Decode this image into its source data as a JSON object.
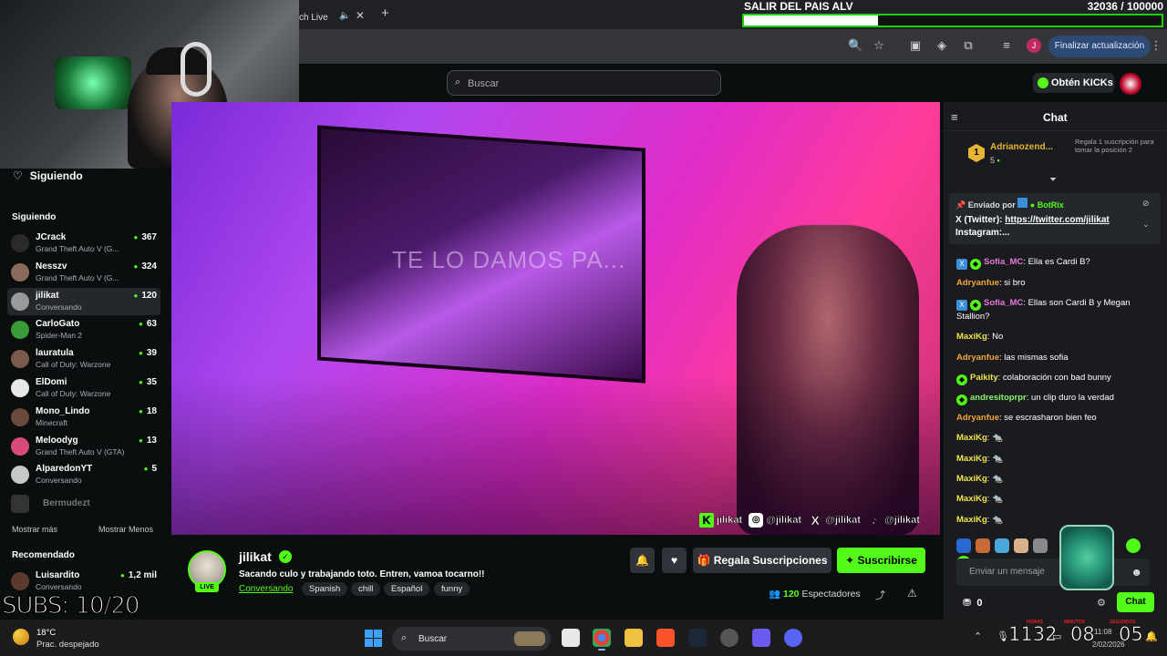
{
  "browser": {
    "tab_title": "ch Live",
    "update_button": "Finalizar actualización",
    "profile_initial": "J"
  },
  "goal": {
    "title": "SALIR DEL PAIS ALV",
    "count": "32036  / 100000",
    "progress_fraction": 0.32
  },
  "header": {
    "search_placeholder": "Buscar",
    "kicks_label": "Obtén KICKs"
  },
  "sidebar": {
    "following_header": "Siguiendo",
    "following_section": "Siguiendo",
    "channels": [
      {
        "name": "JCrack",
        "game": "Grand Theft Auto V (G...",
        "viewers": "367",
        "color": "#2a2a2a"
      },
      {
        "name": "Nesszv",
        "game": "Grand Theft Auto V (G...",
        "viewers": "324",
        "color": "#8a6a5a"
      },
      {
        "name": "jilikat",
        "game": "Conversando",
        "viewers": "120",
        "color": "#9a9a9a"
      },
      {
        "name": "CarloGato",
        "game": "Spider-Man 2",
        "viewers": "63",
        "color": "#3a9a3a"
      },
      {
        "name": "lauratula",
        "game": "Call of Duty: Warzone",
        "viewers": "39",
        "color": "#7a5a4a"
      },
      {
        "name": "ElDomi",
        "game": "Call of Duty: Warzone",
        "viewers": "35",
        "color": "#e8e8e8"
      },
      {
        "name": "Mono_Lindo",
        "game": "Minecraft",
        "viewers": "18",
        "color": "#6a4a3a"
      },
      {
        "name": "Meloodyg",
        "game": "Grand Theft Auto V (GTA)",
        "viewers": "13",
        "color": "#d84a7a"
      },
      {
        "name": "AlparedonYT",
        "game": "Conversando",
        "viewers": "5",
        "color": "#c8c8c8"
      }
    ],
    "offline_channel": "Bermudezt",
    "show_more": "Mostrar más",
    "show_less": "Mostrar Menos",
    "recommended_section": "Recomendado",
    "recommended": [
      {
        "name": "Luisardito",
        "game": "Conversando",
        "viewers": "1,2 mil",
        "color": "#5a3a2a"
      }
    ],
    "subs_overlay": "SUBS: 10/20"
  },
  "video": {
    "tv_text": "TE LO DAMOS PA...",
    "socials": [
      "jilikat",
      "@jilikat",
      "@jilikat",
      "@jilikat"
    ]
  },
  "stream": {
    "streamer": "jilikat",
    "live_label": "LIVE",
    "title": "Sacando culo y trabajando toto. Entren, vamoa tocarno!!",
    "category": "Conversando",
    "tags": [
      "Spanish",
      "chill",
      "Español",
      "funny"
    ],
    "gift_button": "Regala Suscripciones",
    "subscribe_button": "Suscribirse",
    "viewers_count": "120",
    "viewers_label": "Espectadores"
  },
  "chat": {
    "title": "Chat",
    "top_gifter": {
      "name": "Adrianozend...",
      "rank": "1",
      "count": "5",
      "note": "Regala 1 suscripción para tomar la posición 2"
    },
    "pinned": {
      "sent_by_label": "Enviado por",
      "sender": "BotRix",
      "line1_prefix": "X (Twitter): ",
      "line1_link": "https://twitter.com/jilikat",
      "line2": "Instagram:..."
    },
    "messages": [
      {
        "user": "Sofia_MC",
        "color": "#e87ad8",
        "badges": [
          "x",
          "g"
        ],
        "text": "Ella es Cardi B?"
      },
      {
        "user": "Adryanfue",
        "color": "#f2a63a",
        "badges": [],
        "text": "si bro"
      },
      {
        "user": "Sofia_MC",
        "color": "#e87ad8",
        "badges": [
          "x",
          "g"
        ],
        "text": "Ellas son Cardi B y Megan Stallion?"
      },
      {
        "user": "MaxiKg",
        "color": "#f0e44a",
        "badges": [],
        "text": "No"
      },
      {
        "user": "Adryanfue",
        "color": "#f2a63a",
        "badges": [],
        "text": "las mismas sofia"
      },
      {
        "user": "Paikity",
        "color": "#f0e44a",
        "badges": [
          "g"
        ],
        "text": "colaboración con bad bunny"
      },
      {
        "user": "andresitoprpr",
        "color": "#8af56a",
        "badges": [
          "g"
        ],
        "text": "un clip duro la verdad"
      },
      {
        "user": "Adryanfue",
        "color": "#f2a63a",
        "badges": [],
        "text": "se escrasharon bien feo"
      },
      {
        "user": "MaxiKg",
        "color": "#f0e44a",
        "badges": [],
        "text": "🐀"
      },
      {
        "user": "MaxiKg",
        "color": "#f0e44a",
        "badges": [],
        "text": "🐀"
      },
      {
        "user": "MaxiKg",
        "color": "#f0e44a",
        "badges": [],
        "text": "🐀"
      },
      {
        "user": "MaxiKg",
        "color": "#f0e44a",
        "badges": [],
        "text": "🐀"
      },
      {
        "user": "MaxiKg",
        "color": "#f0e44a",
        "badges": [],
        "text": "🐀"
      }
    ],
    "input_placeholder": "Enviar un mensaje",
    "points": "0",
    "send_button": "Chat"
  },
  "taskbar": {
    "temp": "18°C",
    "weather": "Prac. despejado",
    "search_placeholder": "Buscar",
    "clock_hours": "1132",
    "clock_minutes": "08",
    "clock_seconds": "05",
    "clock_time_small": "11:08",
    "clock_date_small": "2/02/2026",
    "label_hours": "HORAS",
    "label_minutes": "MINUTOS",
    "label_seconds": "SEGUNDOS"
  }
}
